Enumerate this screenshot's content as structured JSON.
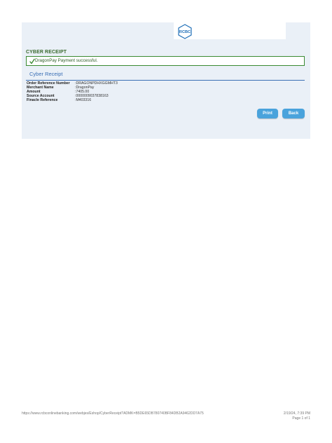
{
  "header": {
    "logo_text": "RCBC",
    "brand_color": "#1f6fb8",
    "logo_icon": "rcbc-hexagon-logo"
  },
  "receipt": {
    "title": "CYBER RECEIPT",
    "success_message": "DragonPay Payment successful.",
    "success_icon": "check-icon",
    "section_title": "Cyber Receipt",
    "fields": [
      {
        "label": "Order Reference Number",
        "value": "DRAGONPDHXGGMHT3"
      },
      {
        "label": "Merchant Name",
        "value": "DragonPay"
      },
      {
        "label": "Amount",
        "value": "7405.00"
      },
      {
        "label": "Source Account",
        "value": "0000009037838163"
      },
      {
        "label": "Finacle Reference",
        "value": "M403316"
      }
    ]
  },
  "actions": {
    "print_label": "Print",
    "back_label": "Back",
    "button_color": "#4aa3dc"
  },
  "footer": {
    "url": "https://www.rcbconlinebanking.com/webjes/Eshop/CyberReceipt?ADMK=B5DE65DB780740BF84DB2A9462DD7A75",
    "datetime": "2/19/24, 7:39 PM",
    "page": "Page 1 of 1"
  }
}
